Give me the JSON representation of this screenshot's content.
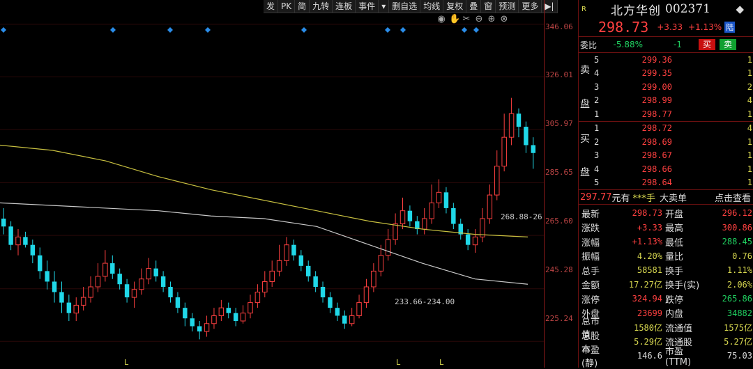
{
  "toolbar": [
    "发",
    "PK",
    "简",
    "九转",
    "连板",
    "事件",
    "▾",
    "删自选",
    "均线",
    "复权",
    "叠",
    "窗",
    "预测",
    "更多",
    "▶|"
  ],
  "chart_tools": [
    "eye-icon",
    "hand-icon",
    "scissors-icon",
    "zoom-out-icon",
    "zoom-in-icon",
    "close-icon"
  ],
  "yaxis": [
    "346.06",
    "326.01",
    "305.97",
    "285.65",
    "265.60",
    "245.28",
    "225.24"
  ],
  "tags": {
    "high": "268.88-26",
    "low": "233.66-234.00"
  },
  "lmarks": [
    "L",
    "L",
    "L"
  ],
  "colors": {
    "up": "#ff4040",
    "down": "#20d8e8",
    "ma1": "#c8c040",
    "ma2": "#c8c8c8",
    "panel_border": "#6a1010"
  },
  "chart_data": {
    "type": "candlestick",
    "ylim": [
      220,
      350
    ],
    "ma_series": [
      {
        "values": [
          300,
          298,
          294,
          288,
          283,
          279,
          275,
          271,
          268,
          266,
          265
        ]
      },
      {
        "values": [
          278,
          277,
          276,
          275,
          273,
          272,
          269,
          262,
          255,
          249,
          247
        ]
      }
    ],
    "candles": [
      [
        272,
        269,
        276,
        266
      ],
      [
        269,
        262,
        271,
        260
      ],
      [
        262,
        265,
        268,
        258
      ],
      [
        265,
        262,
        267,
        261
      ],
      [
        262,
        258,
        264,
        255
      ],
      [
        258,
        252,
        261,
        249
      ],
      [
        252,
        248,
        256,
        245
      ],
      [
        248,
        244,
        252,
        240
      ],
      [
        244,
        240,
        248,
        236
      ],
      [
        240,
        236,
        243,
        233
      ],
      [
        236,
        239,
        242,
        233
      ],
      [
        239,
        242,
        246,
        237
      ],
      [
        242,
        246,
        250,
        240
      ],
      [
        246,
        250,
        255,
        244
      ],
      [
        250,
        255,
        260,
        248
      ],
      [
        255,
        251,
        258,
        249
      ],
      [
        251,
        247,
        253,
        245
      ],
      [
        247,
        242,
        249,
        240
      ],
      [
        242,
        245,
        248,
        238
      ],
      [
        245,
        249,
        253,
        243
      ],
      [
        249,
        253,
        257,
        247
      ],
      [
        253,
        250,
        256,
        248
      ],
      [
        250,
        246,
        252,
        244
      ],
      [
        246,
        242,
        248,
        240
      ],
      [
        242,
        238,
        244,
        236
      ],
      [
        238,
        234,
        240,
        231
      ],
      [
        234,
        231,
        236,
        229
      ],
      [
        231,
        229,
        233,
        226
      ],
      [
        229,
        232,
        235,
        227
      ],
      [
        232,
        235,
        238,
        230
      ],
      [
        235,
        238,
        241,
        233
      ],
      [
        238,
        236,
        240,
        234
      ],
      [
        236,
        233,
        238,
        231
      ],
      [
        233,
        236,
        239,
        232
      ],
      [
        236,
        240,
        243,
        234
      ],
      [
        240,
        244,
        247,
        238
      ],
      [
        244,
        248,
        252,
        242
      ],
      [
        248,
        252,
        256,
        246
      ],
      [
        252,
        256,
        262,
        250
      ],
      [
        256,
        262,
        265,
        254
      ],
      [
        262,
        258,
        264,
        256
      ],
      [
        258,
        254,
        260,
        252
      ],
      [
        254,
        250,
        256,
        248
      ],
      [
        250,
        246,
        252,
        244
      ],
      [
        246,
        242,
        248,
        240
      ],
      [
        242,
        238,
        244,
        236
      ],
      [
        238,
        235,
        240,
        233
      ],
      [
        235,
        232,
        237,
        230
      ],
      [
        232,
        235,
        238,
        231
      ],
      [
        235,
        240,
        243,
        234
      ],
      [
        240,
        246,
        249,
        238
      ],
      [
        246,
        252,
        255,
        244
      ],
      [
        252,
        258,
        262,
        250
      ],
      [
        258,
        264,
        268,
        256
      ],
      [
        264,
        270,
        274,
        262
      ],
      [
        270,
        275,
        280,
        268
      ],
      [
        275,
        271,
        277,
        269
      ],
      [
        271,
        268,
        273,
        266
      ],
      [
        268,
        272,
        276,
        266
      ],
      [
        272,
        278,
        285,
        270
      ],
      [
        278,
        282,
        287,
        276
      ],
      [
        282,
        276,
        284,
        274
      ],
      [
        276,
        270,
        278,
        268
      ],
      [
        270,
        266,
        272,
        264
      ],
      [
        266,
        262,
        268,
        260
      ],
      [
        262,
        265,
        268,
        259
      ],
      [
        265,
        272,
        276,
        263
      ],
      [
        272,
        281,
        285,
        270
      ],
      [
        281,
        292,
        298,
        279
      ],
      [
        292,
        303,
        312,
        290
      ],
      [
        303,
        312,
        318,
        300
      ],
      [
        312,
        307,
        314,
        303
      ],
      [
        307,
        300,
        309,
        297
      ],
      [
        300,
        297,
        303,
        291
      ]
    ]
  },
  "panel": {
    "badge": "R",
    "name": "北方华创",
    "code": "002371",
    "arrow": "◆",
    "last": "298.73",
    "change": "+3.33",
    "change_pct": "+1.13%",
    "market": "陆",
    "weibi": {
      "label": "委比",
      "value": "-5.88%",
      "diff": "-1",
      "buy": "买",
      "sell": "卖"
    },
    "ask_label": [
      "卖",
      "盘"
    ],
    "bid_label": [
      "买",
      "盘"
    ],
    "asks": [
      {
        "lvl": "5",
        "px": "299.36",
        "vol": "1"
      },
      {
        "lvl": "4",
        "px": "299.35",
        "vol": "1"
      },
      {
        "lvl": "3",
        "px": "299.00",
        "vol": "2"
      },
      {
        "lvl": "2",
        "px": "298.99",
        "vol": "4"
      },
      {
        "lvl": "1",
        "px": "298.77",
        "vol": "1"
      }
    ],
    "bids": [
      {
        "lvl": "1",
        "px": "298.72",
        "vol": "4"
      },
      {
        "lvl": "2",
        "px": "298.69",
        "vol": "1"
      },
      {
        "lvl": "3",
        "px": "298.67",
        "vol": "1"
      },
      {
        "lvl": "4",
        "px": "298.66",
        "vol": "1"
      },
      {
        "lvl": "5",
        "px": "298.64",
        "vol": "1"
      }
    ],
    "trade": {
      "price": "297.77",
      "unit": "元有",
      "hands": "***手",
      "big": "大卖单",
      "link": "点击查看"
    },
    "stats": [
      {
        "l1": "最新",
        "v1": "298.73",
        "c1": "red",
        "l2": "开盘",
        "v2": "296.12",
        "c2": "red"
      },
      {
        "l1": "涨跌",
        "v1": "+3.33",
        "c1": "red",
        "l2": "最高",
        "v2": "300.86",
        "c2": "red"
      },
      {
        "l1": "涨幅",
        "v1": "+1.13%",
        "c1": "red",
        "l2": "最低",
        "v2": "288.45",
        "c2": "green"
      },
      {
        "l1": "振幅",
        "v1": "4.20%",
        "c1": "yellow",
        "l2": "量比",
        "v2": "0.76",
        "c2": "yellow"
      },
      {
        "l1": "总手",
        "v1": "58581",
        "c1": "yellow",
        "l2": "换手",
        "v2": "1.11%",
        "c2": "yellow"
      },
      {
        "l1": "金额",
        "v1": "17.27亿",
        "c1": "yellow",
        "l2": "换手(实)",
        "v2": "2.06%",
        "c2": "yellow"
      },
      {
        "l1": "涨停",
        "v1": "324.94",
        "c1": "red",
        "l2": "跌停",
        "v2": "265.86",
        "c2": "green"
      },
      {
        "l1": "外盘",
        "v1": "23699",
        "c1": "red",
        "l2": "内盘",
        "v2": "34882",
        "c2": "green"
      },
      {
        "l1": "总市值",
        "v1": "1580亿",
        "c1": "yellow",
        "l2": "流通值",
        "v2": "1575亿",
        "c2": "yellow"
      },
      {
        "l1": "总股本",
        "v1": "5.29亿",
        "c1": "yellow",
        "l2": "流通股",
        "v2": "5.27亿",
        "c2": "yellow"
      },
      {
        "l1": "市盈(静)",
        "v1": "146.6",
        "c1": "white",
        "l2": "市盈(TTM)",
        "v2": "75.03",
        "c2": "white"
      }
    ]
  }
}
